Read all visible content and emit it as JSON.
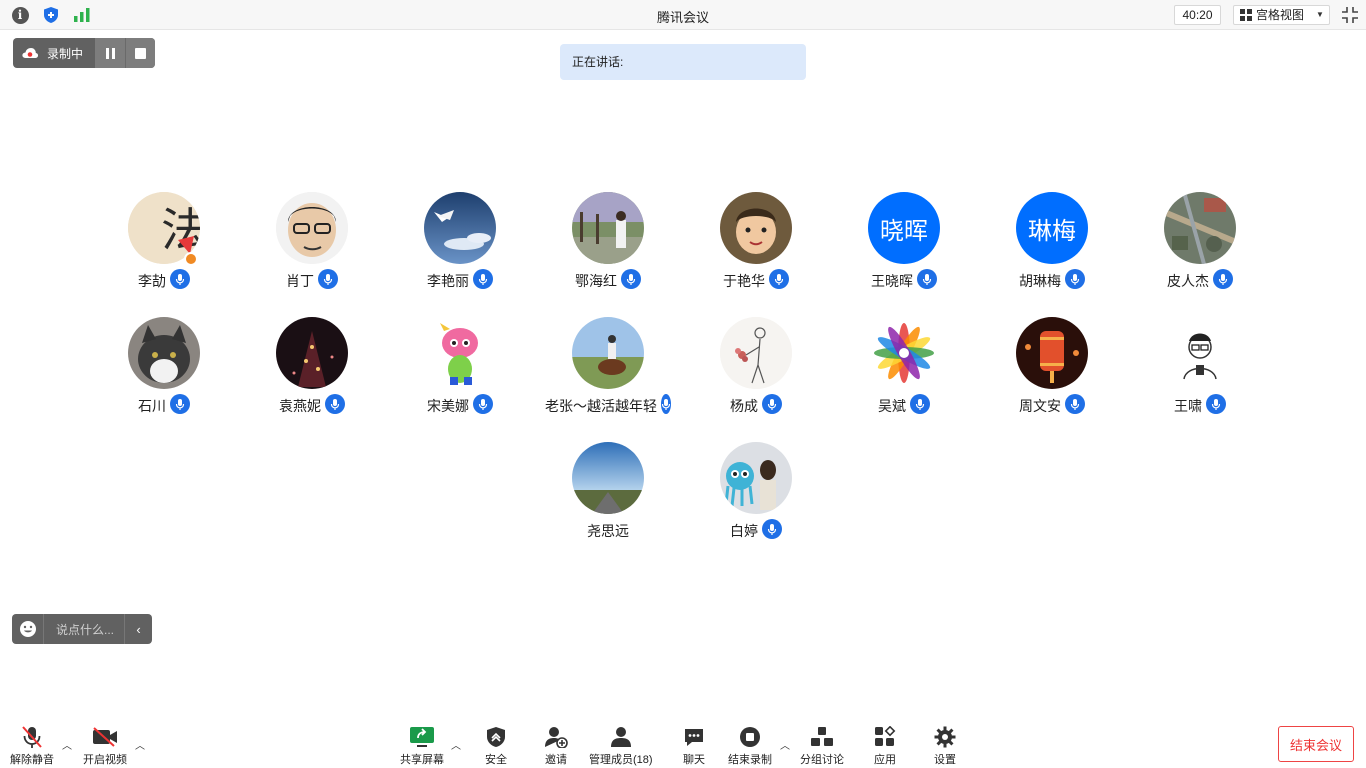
{
  "window": {
    "title": "腾讯会议",
    "timer": "40:20",
    "view_mode": "宫格视图"
  },
  "recording": {
    "label": "录制中"
  },
  "speaking_banner": "正在讲话:",
  "participants": [
    {
      "name": "李劼",
      "avatar_text": "",
      "muted": false,
      "host": true
    },
    {
      "name": "肖丁",
      "avatar_text": "",
      "muted": false
    },
    {
      "name": "李艳丽",
      "avatar_text": "",
      "muted": false
    },
    {
      "name": "鄂海红",
      "avatar_text": "",
      "muted": false
    },
    {
      "name": "于艳华",
      "avatar_text": "",
      "muted": false
    },
    {
      "name": "王晓晖",
      "avatar_text": "晓晖",
      "muted": false
    },
    {
      "name": "胡琳梅",
      "avatar_text": "琳梅",
      "muted": false
    },
    {
      "name": "皮人杰",
      "avatar_text": "",
      "muted": false
    },
    {
      "name": "石川",
      "avatar_text": "",
      "muted": false
    },
    {
      "name": "袁燕妮",
      "avatar_text": "",
      "muted": false
    },
    {
      "name": "宋美娜",
      "avatar_text": "",
      "muted": false
    },
    {
      "name": "老张～越活越年轻",
      "avatar_text": "",
      "muted": false
    },
    {
      "name": "杨成",
      "avatar_text": "",
      "muted": false
    },
    {
      "name": "吴斌",
      "avatar_text": "",
      "muted": false
    },
    {
      "name": "周文安",
      "avatar_text": "",
      "muted": false
    },
    {
      "name": "王啸",
      "avatar_text": "",
      "muted": false
    },
    {
      "name": "尧思远",
      "avatar_text": "",
      "muted": true
    },
    {
      "name": "白婷",
      "avatar_text": "",
      "muted": false
    }
  ],
  "chat": {
    "placeholder": "说点什么..."
  },
  "toolbar": {
    "unmute": "解除静音",
    "start_video": "开启视频",
    "share_screen": "共享屏幕",
    "security": "安全",
    "invite": "邀请",
    "manage_members": "管理成员(18)",
    "chat": "聊天",
    "end_recording": "结束录制",
    "breakout": "分组讨论",
    "apps": "应用",
    "settings": "设置",
    "end_meeting": "结束会议"
  },
  "colors": {
    "accent": "#1f6fe6",
    "avatar_blue": "#006eff",
    "end_red": "#e33333"
  }
}
